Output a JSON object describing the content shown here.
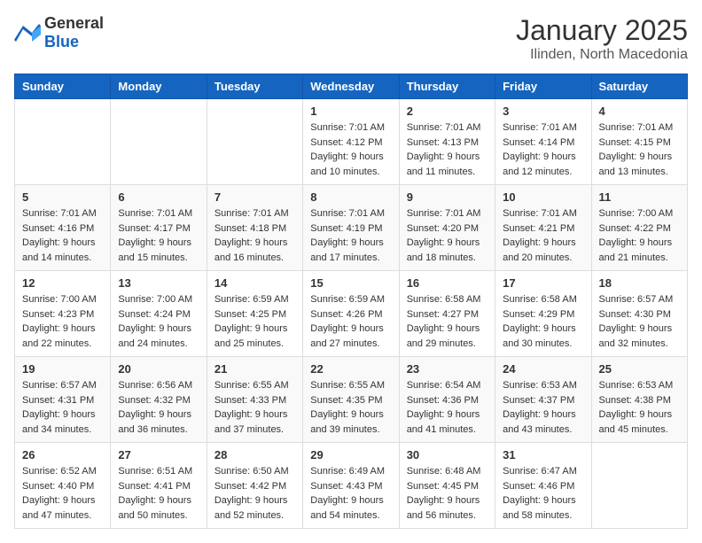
{
  "header": {
    "logo_general": "General",
    "logo_blue": "Blue",
    "month": "January 2025",
    "location": "Ilinden, North Macedonia"
  },
  "weekdays": [
    "Sunday",
    "Monday",
    "Tuesday",
    "Wednesday",
    "Thursday",
    "Friday",
    "Saturday"
  ],
  "weeks": [
    [
      {
        "day": "",
        "info": ""
      },
      {
        "day": "",
        "info": ""
      },
      {
        "day": "",
        "info": ""
      },
      {
        "day": "1",
        "info": "Sunrise: 7:01 AM\nSunset: 4:12 PM\nDaylight: 9 hours and 10 minutes."
      },
      {
        "day": "2",
        "info": "Sunrise: 7:01 AM\nSunset: 4:13 PM\nDaylight: 9 hours and 11 minutes."
      },
      {
        "day": "3",
        "info": "Sunrise: 7:01 AM\nSunset: 4:14 PM\nDaylight: 9 hours and 12 minutes."
      },
      {
        "day": "4",
        "info": "Sunrise: 7:01 AM\nSunset: 4:15 PM\nDaylight: 9 hours and 13 minutes."
      }
    ],
    [
      {
        "day": "5",
        "info": "Sunrise: 7:01 AM\nSunset: 4:16 PM\nDaylight: 9 hours and 14 minutes."
      },
      {
        "day": "6",
        "info": "Sunrise: 7:01 AM\nSunset: 4:17 PM\nDaylight: 9 hours and 15 minutes."
      },
      {
        "day": "7",
        "info": "Sunrise: 7:01 AM\nSunset: 4:18 PM\nDaylight: 9 hours and 16 minutes."
      },
      {
        "day": "8",
        "info": "Sunrise: 7:01 AM\nSunset: 4:19 PM\nDaylight: 9 hours and 17 minutes."
      },
      {
        "day": "9",
        "info": "Sunrise: 7:01 AM\nSunset: 4:20 PM\nDaylight: 9 hours and 18 minutes."
      },
      {
        "day": "10",
        "info": "Sunrise: 7:01 AM\nSunset: 4:21 PM\nDaylight: 9 hours and 20 minutes."
      },
      {
        "day": "11",
        "info": "Sunrise: 7:00 AM\nSunset: 4:22 PM\nDaylight: 9 hours and 21 minutes."
      }
    ],
    [
      {
        "day": "12",
        "info": "Sunrise: 7:00 AM\nSunset: 4:23 PM\nDaylight: 9 hours and 22 minutes."
      },
      {
        "day": "13",
        "info": "Sunrise: 7:00 AM\nSunset: 4:24 PM\nDaylight: 9 hours and 24 minutes."
      },
      {
        "day": "14",
        "info": "Sunrise: 6:59 AM\nSunset: 4:25 PM\nDaylight: 9 hours and 25 minutes."
      },
      {
        "day": "15",
        "info": "Sunrise: 6:59 AM\nSunset: 4:26 PM\nDaylight: 9 hours and 27 minutes."
      },
      {
        "day": "16",
        "info": "Sunrise: 6:58 AM\nSunset: 4:27 PM\nDaylight: 9 hours and 29 minutes."
      },
      {
        "day": "17",
        "info": "Sunrise: 6:58 AM\nSunset: 4:29 PM\nDaylight: 9 hours and 30 minutes."
      },
      {
        "day": "18",
        "info": "Sunrise: 6:57 AM\nSunset: 4:30 PM\nDaylight: 9 hours and 32 minutes."
      }
    ],
    [
      {
        "day": "19",
        "info": "Sunrise: 6:57 AM\nSunset: 4:31 PM\nDaylight: 9 hours and 34 minutes."
      },
      {
        "day": "20",
        "info": "Sunrise: 6:56 AM\nSunset: 4:32 PM\nDaylight: 9 hours and 36 minutes."
      },
      {
        "day": "21",
        "info": "Sunrise: 6:55 AM\nSunset: 4:33 PM\nDaylight: 9 hours and 37 minutes."
      },
      {
        "day": "22",
        "info": "Sunrise: 6:55 AM\nSunset: 4:35 PM\nDaylight: 9 hours and 39 minutes."
      },
      {
        "day": "23",
        "info": "Sunrise: 6:54 AM\nSunset: 4:36 PM\nDaylight: 9 hours and 41 minutes."
      },
      {
        "day": "24",
        "info": "Sunrise: 6:53 AM\nSunset: 4:37 PM\nDaylight: 9 hours and 43 minutes."
      },
      {
        "day": "25",
        "info": "Sunrise: 6:53 AM\nSunset: 4:38 PM\nDaylight: 9 hours and 45 minutes."
      }
    ],
    [
      {
        "day": "26",
        "info": "Sunrise: 6:52 AM\nSunset: 4:40 PM\nDaylight: 9 hours and 47 minutes."
      },
      {
        "day": "27",
        "info": "Sunrise: 6:51 AM\nSunset: 4:41 PM\nDaylight: 9 hours and 50 minutes."
      },
      {
        "day": "28",
        "info": "Sunrise: 6:50 AM\nSunset: 4:42 PM\nDaylight: 9 hours and 52 minutes."
      },
      {
        "day": "29",
        "info": "Sunrise: 6:49 AM\nSunset: 4:43 PM\nDaylight: 9 hours and 54 minutes."
      },
      {
        "day": "30",
        "info": "Sunrise: 6:48 AM\nSunset: 4:45 PM\nDaylight: 9 hours and 56 minutes."
      },
      {
        "day": "31",
        "info": "Sunrise: 6:47 AM\nSunset: 4:46 PM\nDaylight: 9 hours and 58 minutes."
      },
      {
        "day": "",
        "info": ""
      }
    ]
  ]
}
